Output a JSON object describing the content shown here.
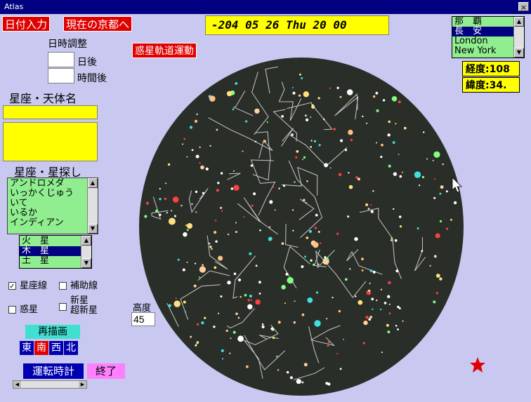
{
  "window": {
    "title": "Atlas",
    "close": "×"
  },
  "buttons": {
    "date_input": "日付入力",
    "now_kyoto": "現在の京都へ",
    "planet_motion": "惑星軌道運動",
    "redraw": "再描画",
    "run_clock": "運転時計",
    "exit": "終了"
  },
  "datetime": "-204 05 26 Thu 20 00",
  "time_adjust": {
    "title": "日時調整",
    "days_label": "日後",
    "hours_label": "時間後",
    "days_value": "",
    "hours_value": ""
  },
  "search": {
    "title": "星座・天体名",
    "value": ""
  },
  "constellation_finder": {
    "title": "星座・星探し",
    "items": [
      "アンドロメダ",
      "いっかくじゅう",
      "いて",
      "いるか",
      "インディアン"
    ]
  },
  "planets": {
    "items": [
      "火　星",
      "木　星",
      "土　星"
    ],
    "selected": 1
  },
  "cities": {
    "items": [
      "那　覇",
      "長　安",
      "London",
      "New York"
    ],
    "selected": 1
  },
  "coords": {
    "longitude": "経度:108",
    "latitude": "緯度:34."
  },
  "options": {
    "constellation_lines": {
      "label": "星座線",
      "checked": true
    },
    "aux_lines": {
      "label": "補助線",
      "checked": false
    },
    "planets": {
      "label": "惑星",
      "checked": false
    },
    "nova": {
      "label": "新星\n超新星",
      "checked": false
    }
  },
  "altitude": {
    "label": "高度",
    "value": "45"
  },
  "directions": [
    "東",
    "南",
    "西",
    "北"
  ],
  "colors": {
    "sky": "#2a2e28",
    "background": "#c8c8f0",
    "red_button": "#e00000",
    "list_bg": "#90ee90",
    "highlight": "#000080"
  }
}
